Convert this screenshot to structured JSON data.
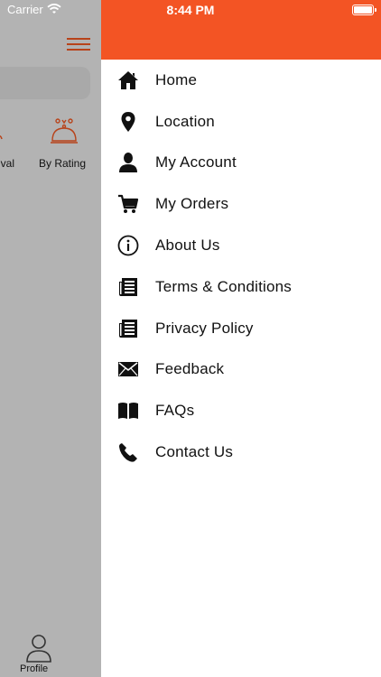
{
  "status_bar": {
    "carrier": "Carrier",
    "time": "8:44 PM"
  },
  "background": {
    "categories": [
      {
        "label": "ival"
      },
      {
        "label": "By Rating"
      }
    ],
    "tab_profile_label": "Profile"
  },
  "menu": {
    "items": [
      {
        "label": "Home",
        "icon": "home-icon"
      },
      {
        "label": "Location",
        "icon": "location-pin-icon"
      },
      {
        "label": "My Account",
        "icon": "user-icon"
      },
      {
        "label": "My Orders",
        "icon": "cart-icon"
      },
      {
        "label": "About Us",
        "icon": "info-icon"
      },
      {
        "label": "Terms & Conditions",
        "icon": "document-icon"
      },
      {
        "label": "Privacy Policy",
        "icon": "document-icon"
      },
      {
        "label": "Feedback",
        "icon": "envelope-icon"
      },
      {
        "label": "FAQs",
        "icon": "book-icon"
      },
      {
        "label": "Contact Us",
        "icon": "phone-icon"
      }
    ]
  },
  "colors": {
    "accent": "#f35424",
    "overlay": "#b3b3b3",
    "accent_dark": "#b8431a"
  }
}
